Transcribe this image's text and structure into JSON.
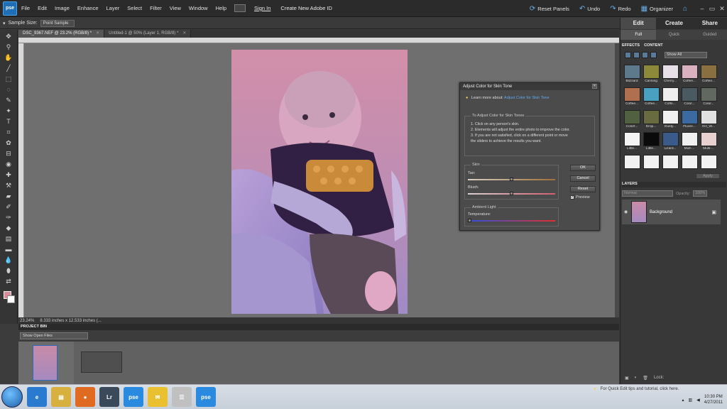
{
  "menubar": {
    "logo": "pse",
    "items": [
      "File",
      "Edit",
      "Image",
      "Enhance",
      "Layer",
      "Select",
      "Filter",
      "View",
      "Window",
      "Help"
    ],
    "signin": "Sign In",
    "create_id": "Create New Adobe ID",
    "reset_panels": "Reset Panels",
    "undo": "Undo",
    "redo": "Redo",
    "organizer": "Organizer"
  },
  "options": {
    "sample_label": "Sample Size:",
    "sample_value": "Point Sample"
  },
  "tabs": [
    {
      "label": "DSC_9367.NEF @ 23.2% (RGB/8) *"
    },
    {
      "label": "Untitled-1 @ 50% (Layer 1, RGB/8) *"
    }
  ],
  "status": {
    "zoom": "23.24%",
    "dims": "8.333 inches x 12.533 inches (..."
  },
  "dialog": {
    "title": "Adjust Color for Skin Tone",
    "learn_prefix": "Learn more about:",
    "learn_link": "Adjust Color for Skin Tone",
    "instr_title": "To Adjust Color for Skin Tones",
    "instructions": [
      "1. Click on any person's skin.",
      "2. Elements will adjust the entire photo to improve the color.",
      "3. If you are not satisfied, click on a different point or move",
      "    the sliders to achieve the results you want."
    ],
    "skin_title": "Skin",
    "tan_label": "Tan:",
    "tan_level": 0.5,
    "blush_label": "Blush:",
    "blush_level": 0.5,
    "ambient_title": "Ambient Light",
    "temp_label": "Temperature:",
    "temp_level": 0.0,
    "ok": "OK",
    "cancel": "Cancel",
    "reset": "Reset",
    "preview": "Preview",
    "preview_checked": true
  },
  "bin": {
    "title": "PROJECT BIN",
    "show": "Show Open Files"
  },
  "rpanel": {
    "tabs": [
      "Edit",
      "Create",
      "Share"
    ],
    "subtabs": [
      "Full",
      "Quick",
      "Guided"
    ],
    "effects_label": "EFFECTS",
    "content_label": "CONTENT",
    "show_all": "Show All",
    "effects": [
      {
        "label": "Blizzard",
        "color": "#5d7a8c"
      },
      {
        "label": "Canning",
        "color": "#8c8a3a"
      },
      {
        "label": "Cherry...",
        "color": "#e8e0e8"
      },
      {
        "label": "Coffee...",
        "color": "#d8b0c0"
      },
      {
        "label": "Coffee...",
        "color": "#8a7040"
      },
      {
        "label": "Coffee...",
        "color": "#b07050"
      },
      {
        "label": "Coffee...",
        "color": "#4aa0c0"
      },
      {
        "label": "Coffe...",
        "color": "#eeeeee"
      },
      {
        "label": "Color...",
        "color": "#4a5a60"
      },
      {
        "label": "Color...",
        "color": "#606860"
      },
      {
        "label": "Colorf...",
        "color": "#506040"
      },
      {
        "label": "Drop...",
        "color": "#686a40"
      },
      {
        "label": "Dusty...",
        "color": "#f0f0f0"
      },
      {
        "label": "Fluore...",
        "color": "#3a6aa0"
      },
      {
        "label": "KH_W...",
        "color": "#e0e0e0"
      },
      {
        "label": "Little...",
        "color": "#f4f4f4"
      },
      {
        "label": "Little...",
        "color": "#0a0a0a"
      },
      {
        "label": "Lizard...",
        "color": "#3a5a8a"
      },
      {
        "label": "Mult-...",
        "color": "#f0f0f0"
      },
      {
        "label": "Multi-...",
        "color": "#e8d0d0"
      },
      {
        "label": "",
        "color": "#f2f2f2"
      },
      {
        "label": "",
        "color": "#f2f2f2"
      },
      {
        "label": "",
        "color": "#f2f2f2"
      },
      {
        "label": "",
        "color": "#f2f2f2"
      },
      {
        "label": "",
        "color": "#f2f2f2"
      }
    ],
    "apply": "Apply",
    "layers_label": "LAYERS",
    "blend": "Normal",
    "opacity_label": "Opacity:",
    "opacity_value": "100%",
    "layer_name": "Background",
    "lock_label": "Lock:"
  },
  "taskbar": {
    "tip": "For Quick Edit tips and tutorial, click here.",
    "time": "10:30 PM",
    "date": "4/27/2011",
    "apps": [
      {
        "name": "internet-explorer",
        "label": "e",
        "color": "#2a7ad0"
      },
      {
        "name": "file-explorer",
        "label": "▤",
        "color": "#d8b040"
      },
      {
        "name": "firefox",
        "label": "●",
        "color": "#e06a20"
      },
      {
        "name": "lightroom",
        "label": "Lr",
        "color": "#3a4a5a"
      },
      {
        "name": "pse-editor",
        "label": "pse",
        "color": "#2a8ae0"
      },
      {
        "name": "mail",
        "label": "✉",
        "color": "#e8c030"
      },
      {
        "name": "documents",
        "label": "☰",
        "color": "#c0c0c0"
      },
      {
        "name": "pse-organizer",
        "label": "pse",
        "color": "#2a8ae0"
      }
    ]
  },
  "icons": {
    "bulb": "●",
    "eye": "◉",
    "lock": "▣"
  }
}
